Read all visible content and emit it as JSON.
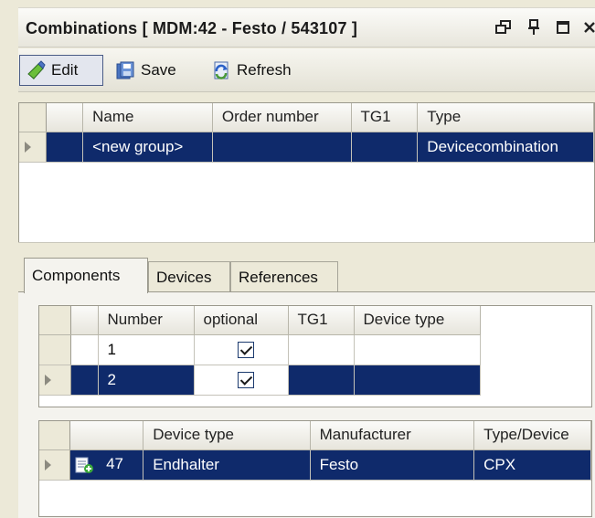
{
  "window": {
    "title": "Combinations [ MDM:42 - Festo / 543107 ]",
    "buttons": [
      "restore-icon",
      "pin-icon",
      "maximize-icon",
      "close-icon"
    ]
  },
  "toolbar": {
    "edit_label": "Edit",
    "save_label": "Save",
    "refresh_label": "Refresh"
  },
  "groups_grid": {
    "columns": [
      "Name",
      "Order number",
      "TG1",
      "Type"
    ],
    "rows": [
      {
        "name": "<new group>",
        "order_number": "",
        "tg1": "",
        "type": "Devicecombination",
        "selected": true
      }
    ]
  },
  "tabs": [
    {
      "label": "Components",
      "active": true
    },
    {
      "label": "Devices",
      "active": false
    },
    {
      "label": "References",
      "active": false
    }
  ],
  "components_grid": {
    "columns": [
      "Number",
      "optional",
      "TG1",
      "Device type"
    ],
    "rows": [
      {
        "number": "1",
        "optional": true,
        "tg1": "",
        "device_type": "",
        "selected": false
      },
      {
        "number": "2",
        "optional": true,
        "tg1": "",
        "device_type": "",
        "selected": true
      }
    ]
  },
  "devices_grid": {
    "columns": [
      "",
      "Device type",
      "Manufacturer",
      "Type/Device"
    ],
    "rows": [
      {
        "id": "47",
        "device_type": "Endhalter",
        "manufacturer": "Festo",
        "type_device": "CPX",
        "selected": true,
        "icon": "device-add-icon"
      }
    ]
  },
  "colors": {
    "selection": "#0f2a6b",
    "chrome": "#ece9d8"
  }
}
